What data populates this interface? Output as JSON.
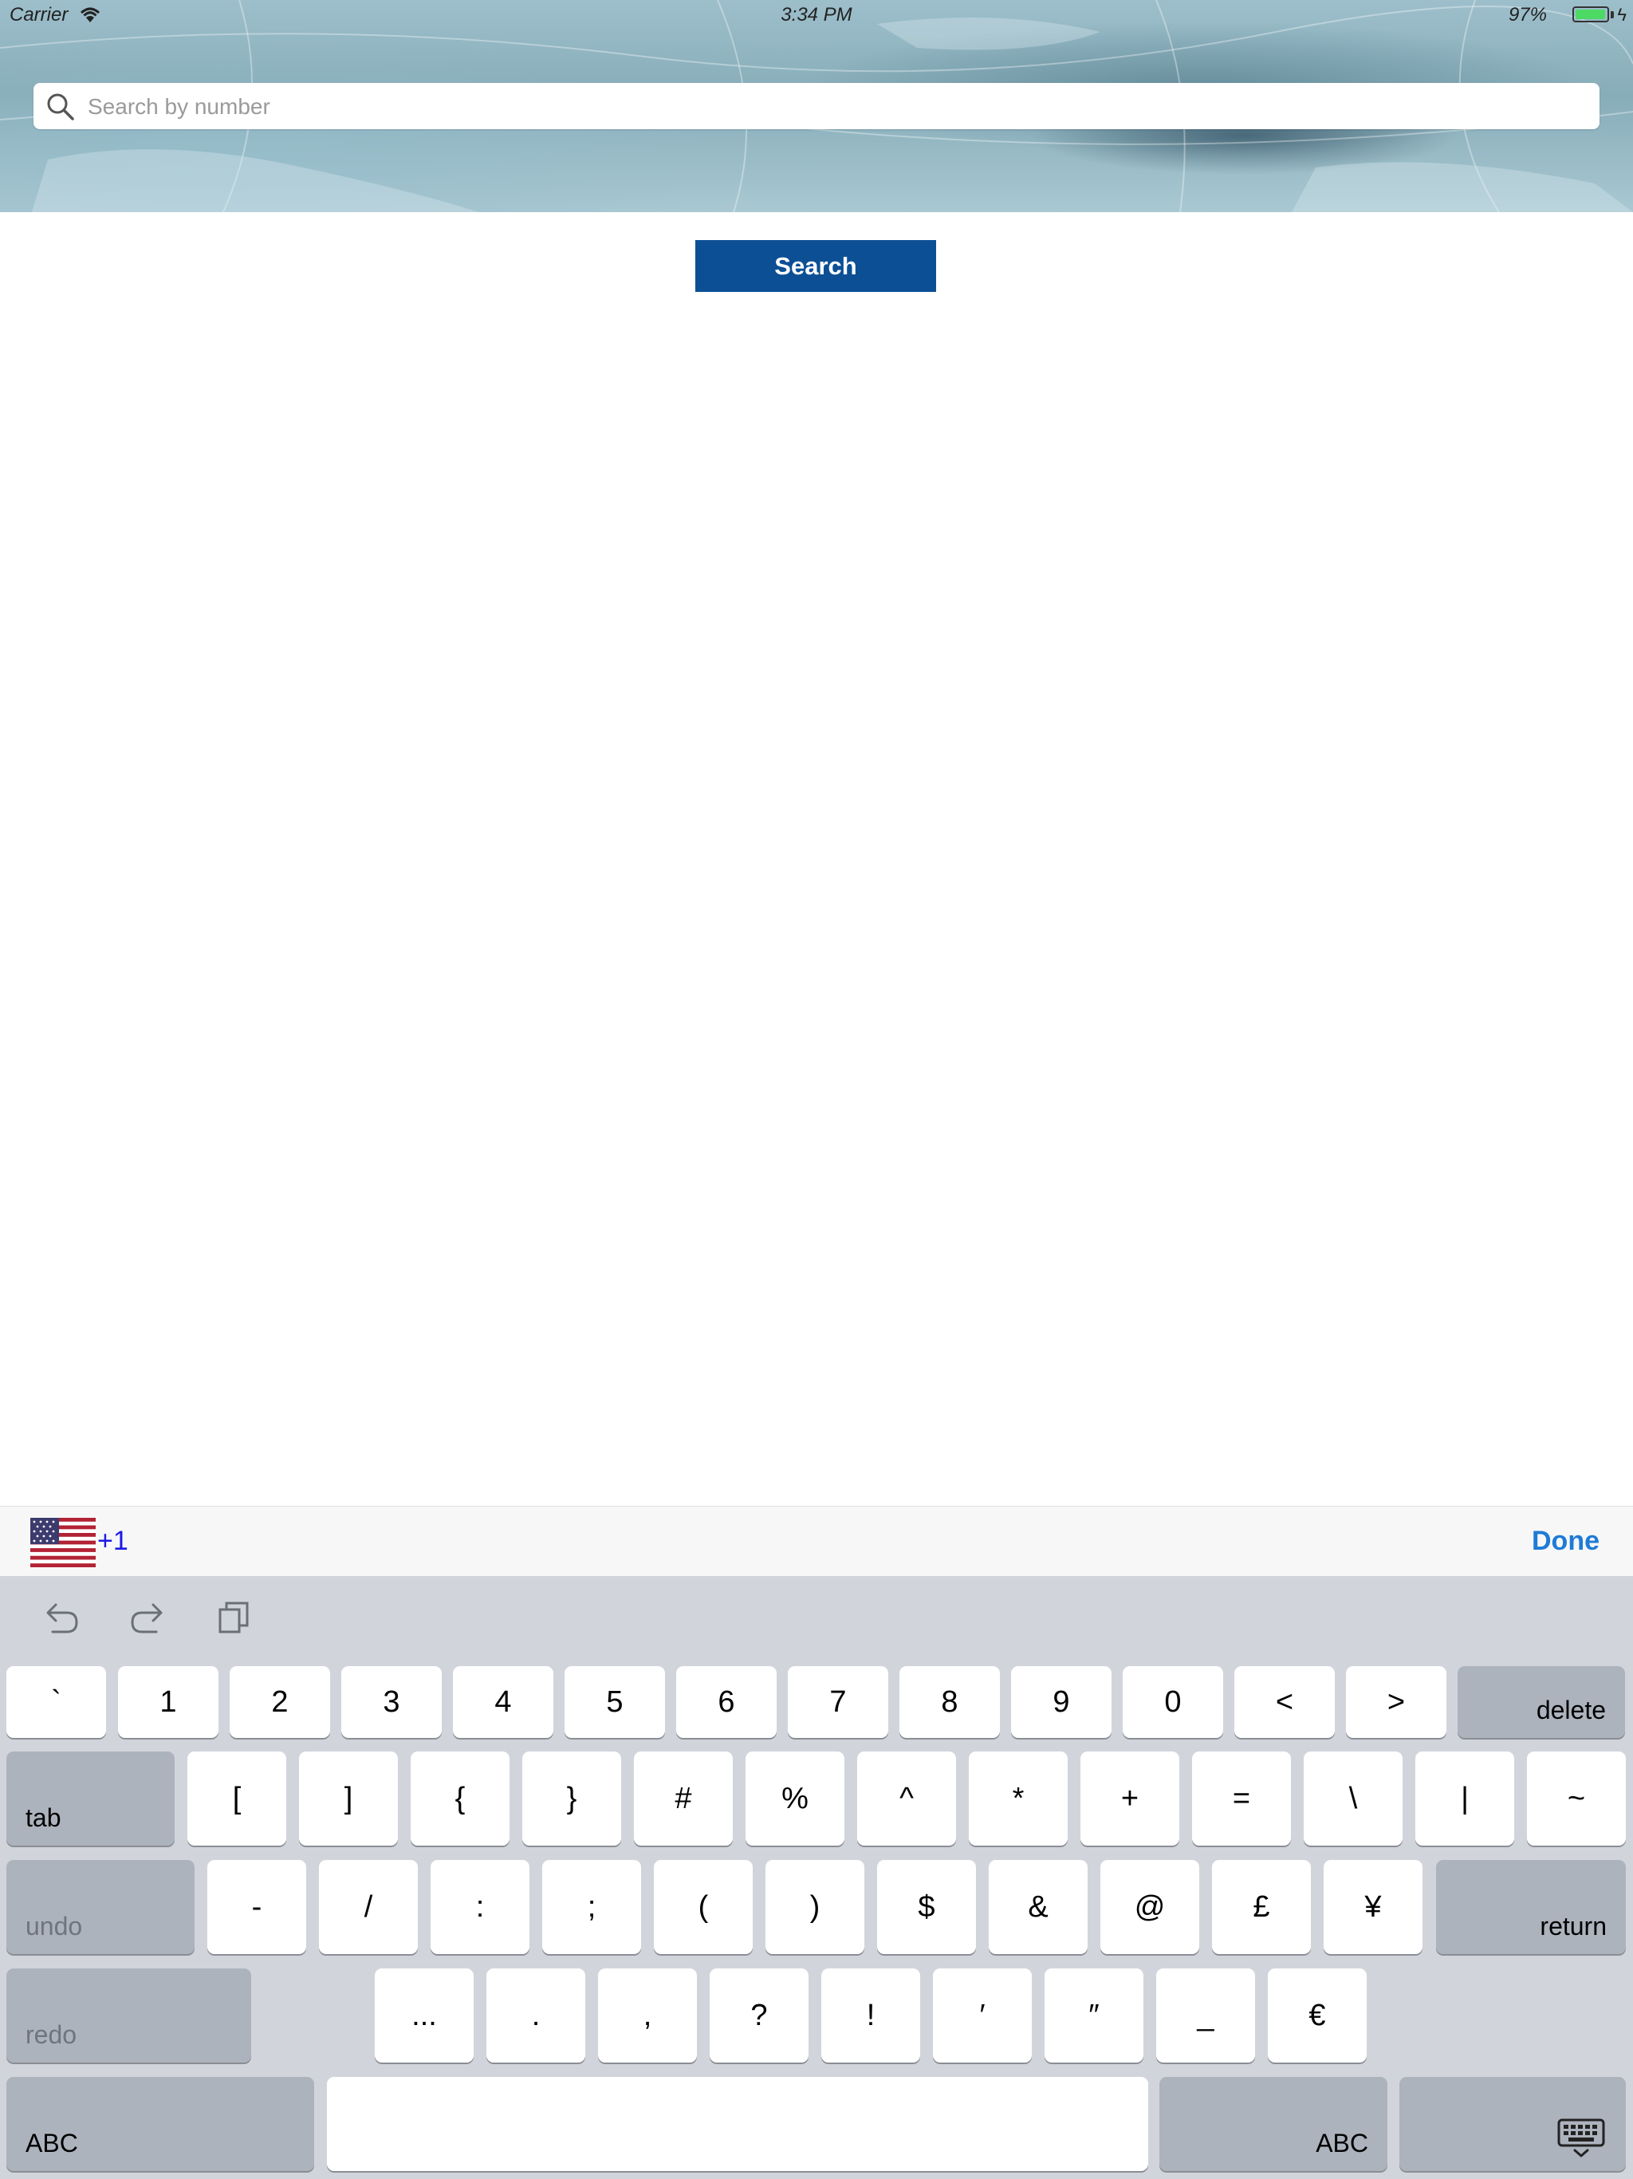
{
  "status_bar": {
    "carrier": "Carrier",
    "time": "3:34 PM",
    "battery": "97%",
    "battery_level": 0.97
  },
  "search": {
    "placeholder": "Search by number",
    "value": "",
    "button_label": "Search"
  },
  "accessory_bar": {
    "country_code": "+1",
    "flag": "us-flag-icon",
    "done_label": "Done"
  },
  "keyboard": {
    "shortcuts": [
      "undo-icon",
      "redo-icon",
      "paste-icon"
    ],
    "row1": [
      "`",
      "1",
      "2",
      "3",
      "4",
      "5",
      "6",
      "7",
      "8",
      "9",
      "0",
      "<",
      ">"
    ],
    "delete": "delete",
    "tab": "tab",
    "row2": [
      "[",
      "]",
      "{",
      "}",
      "#",
      "%",
      "^",
      "*",
      "+",
      "=",
      "\\",
      "|",
      "~"
    ],
    "undo": "undo",
    "row3": [
      "-",
      "/",
      ":",
      ";",
      "(",
      ")",
      "$",
      "&",
      "@",
      "£",
      "¥"
    ],
    "return": "return",
    "redo": "redo",
    "row4": [
      "...",
      ".",
      ",",
      "?",
      "!",
      "′",
      "″",
      "_",
      "€"
    ],
    "abc_left": "ABC",
    "abc_right": "ABC",
    "space": ""
  },
  "colors": {
    "button_blue": "#0c4f95",
    "done_blue": "#1e7bd6",
    "code_blue": "#1a1ae6",
    "keyboard_bg": "#d1d5db"
  }
}
